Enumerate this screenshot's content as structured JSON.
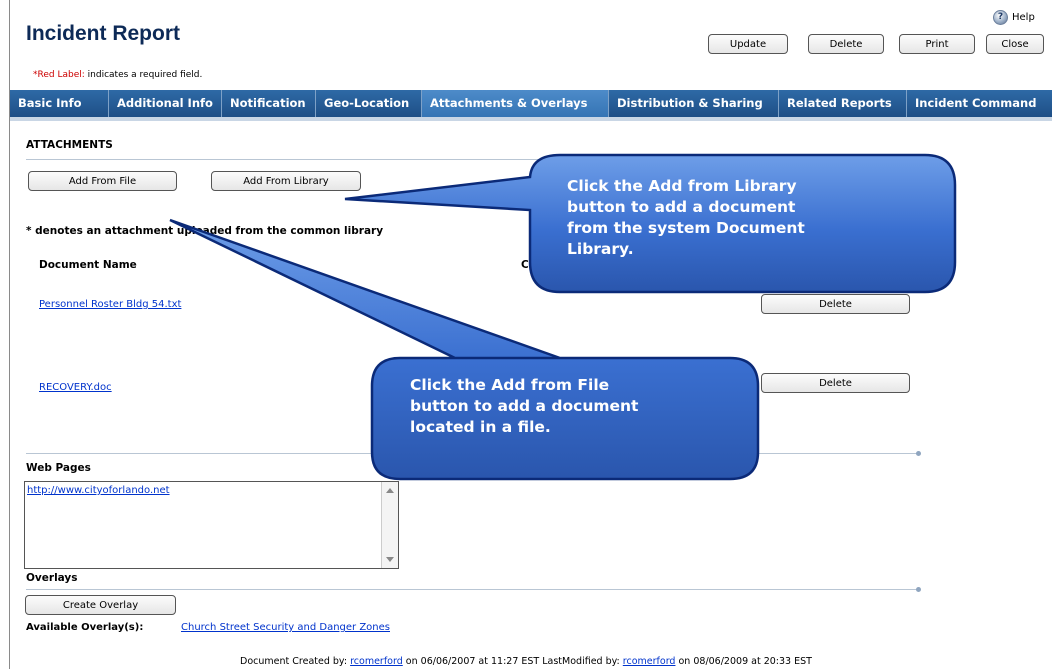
{
  "header": {
    "title": "Incident Report",
    "help_label": "Help",
    "buttons": {
      "update": "Update",
      "delete": "Delete",
      "print": "Print",
      "close": "Close"
    },
    "required_note_red": "*Red Label:",
    "required_note_rest": "indicates a required field."
  },
  "tabs": [
    {
      "label": "Basic Info"
    },
    {
      "label": "Additional Info"
    },
    {
      "label": "Notification"
    },
    {
      "label": "Geo-Location"
    },
    {
      "label": "Attachments & Overlays",
      "active": true
    },
    {
      "label": "Distribution & Sharing"
    },
    {
      "label": "Related Reports"
    },
    {
      "label": "Incident Command"
    }
  ],
  "attachments": {
    "heading": "ATTACHMENTS",
    "add_from_file": "Add From File",
    "add_from_library": "Add From Library",
    "note": "* denotes an attachment uploaded from the common library",
    "column_document_name": "Document Name",
    "column_partial": "C",
    "rows": [
      {
        "name": "Personnel Roster Bldg 54.txt",
        "delete_label": "Delete"
      },
      {
        "name": "RECOVERY.doc",
        "delete_label": "Delete"
      }
    ]
  },
  "web_pages": {
    "heading": "Web Pages",
    "value": "http://www.cityoforlando.net"
  },
  "overlays": {
    "heading": "Overlays",
    "create_label": "Create Overlay",
    "available_label": "Available Overlay(s):",
    "available_link": "Church Street Security and Danger Zones"
  },
  "footer": {
    "created_prefix": "Document Created by:",
    "created_user": "rcomerford",
    "created_date": "on 06/06/2007 at 11:27 EST LastModified by:",
    "modified_user": "rcomerford",
    "modified_date": "on 08/06/2009 at 20:33 EST"
  },
  "callouts": {
    "library": "Click the Add from Library\nbutton to add a document\nfrom the system Document\nLibrary.",
    "file": "Click the Add from File\nbutton to add a document\nlocated in a file."
  },
  "colors": {
    "tab_bar": "#1e4f86",
    "tab_active": "#3574b4",
    "callout_fill": "#3a6fd0",
    "link": "#0033cc",
    "required_red": "#cc0000",
    "title": "#0d2a57"
  }
}
